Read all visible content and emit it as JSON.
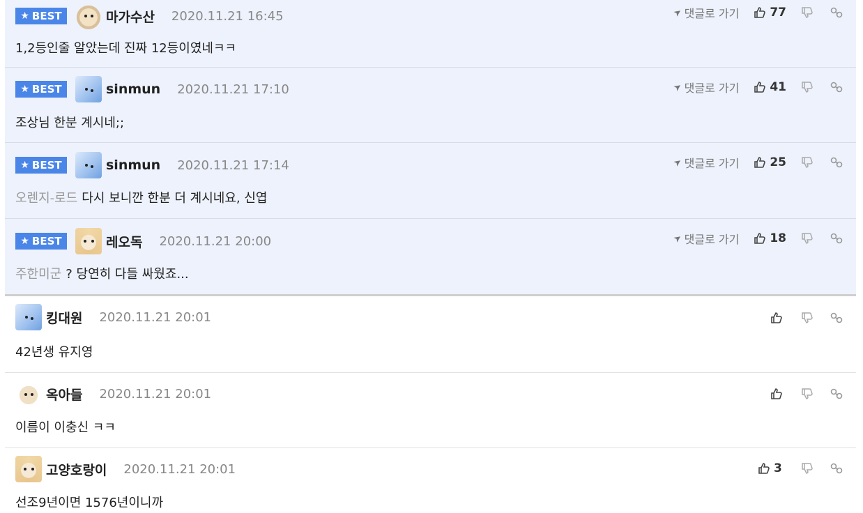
{
  "best_label": "BEST",
  "goto_label": "댓글로 가기",
  "comments": [
    {
      "nick": "마가수산",
      "date": "2020.11.21 16:45",
      "mention": "",
      "text": "1,2등인줄 알았는데 진짜 12등이였네ㅋㅋ",
      "likes": "77"
    },
    {
      "nick": "sinmun",
      "date": "2020.11.21 17:10",
      "mention": "",
      "text": "조상님 한분 계시네;;",
      "likes": "41"
    },
    {
      "nick": "sinmun",
      "date": "2020.11.21 17:14",
      "mention": "오렌지-로드",
      "text": "다시 보니깐 한분 더 계시네요, 신엽",
      "likes": "25"
    },
    {
      "nick": "레오독",
      "date": "2020.11.21 20:00",
      "mention": "주한미군",
      "text": "? 당연히 다들 싸웠죠...",
      "likes": "18"
    },
    {
      "nick": "킹대원",
      "date": "2020.11.21 20:01",
      "mention": "",
      "text": "42년생 유지영",
      "likes": ""
    },
    {
      "nick": "옥아들",
      "date": "2020.11.21 20:01",
      "mention": "",
      "text": "이름이 이충신 ㅋㅋ",
      "likes": ""
    },
    {
      "nick": "고양호랑이",
      "date": "2020.11.21 20:01",
      "mention": "",
      "text": "선조9년이면 1576년이니까",
      "likes": "3"
    }
  ]
}
